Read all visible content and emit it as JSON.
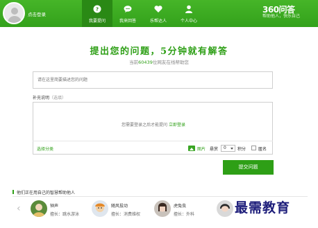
{
  "header": {
    "login_link": "点击登录",
    "nav": [
      {
        "label": "我要提问",
        "icon": "question-bubble-icon",
        "active": true
      },
      {
        "label": "我来回答",
        "icon": "chat-bubbles-icon",
        "active": false
      },
      {
        "label": "乐帮达人",
        "icon": "heart-icon",
        "active": false
      },
      {
        "label": "个人中心",
        "icon": "user-icon",
        "active": false
      }
    ],
    "brand_logo": "360问答",
    "brand_tagline": "帮助他人，快乐自己",
    "accent_color": "#33a11b"
  },
  "main": {
    "headline": "提出您的问题，5分钟就有解答",
    "subline_prefix": "当前",
    "subline_count": "60439",
    "subline_suffix": "位网友在线帮助您",
    "question_placeholder": "请在这里简要描述您的问题",
    "supplement_label": "补充说明",
    "supplement_hint": "（选填）",
    "need_login_text": "您需要登录之后才能提问",
    "login_now": "立即登录",
    "choose_category": "选择分类",
    "image_label": "图片",
    "reward_label": "悬赏",
    "reward_value": "0",
    "points_label": "积分",
    "anonymous_label": "匿名",
    "submit_button": "提交问题"
  },
  "helpers": {
    "title": "他们正在用自己的智慧帮助他人",
    "prev_arrow": "‹",
    "people": [
      {
        "name": "钟声",
        "specialty": "擅长：跳水游泳"
      },
      {
        "name": "随风投动",
        "specialty": "擅长：消费维权"
      },
      {
        "name": "虎兔虫",
        "specialty": "擅长：外科"
      },
      {
        "name": "",
        "specialty": ""
      }
    ]
  },
  "watermark": "最需教育"
}
